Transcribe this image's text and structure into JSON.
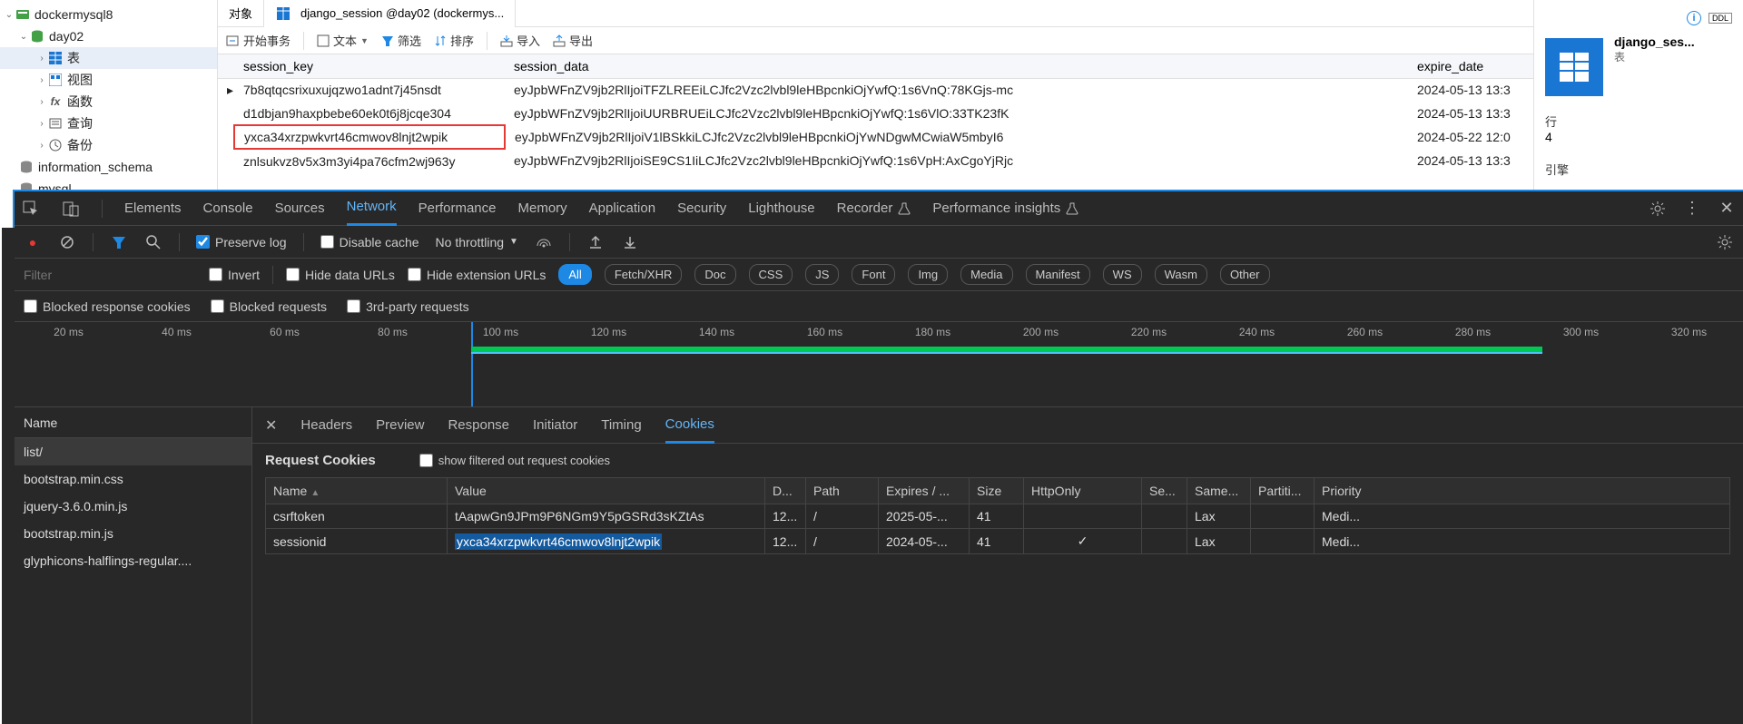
{
  "tree": {
    "root": "dockermysql8",
    "active_db": "day02",
    "nodes": {
      "tables": "表",
      "views": "视图",
      "functions": "函数",
      "queries": "查询",
      "backups": "备份"
    },
    "other_dbs": [
      "information_schema",
      "mysql"
    ]
  },
  "tabs": {
    "obj": "对象",
    "session": "django_session @day02 (dockermys..."
  },
  "toolbar": {
    "begin_tx": "开始事务",
    "text": "文本",
    "filter": "筛选",
    "sort": "排序",
    "import": "导入",
    "export": "导出"
  },
  "grid": {
    "headers": {
      "session_key": "session_key",
      "session_data": "session_data",
      "expire_date": "expire_date"
    },
    "rows": [
      {
        "key": "7b8qtqcsrixuxujqzwo1adnt7j45nsdt",
        "data": "eyJpbWFnZV9jb2RlIjoiTFZLREEiLCJfc2Vzc2lvbl9leHBpcnkiOjYwfQ:1s6VnQ:78KGjs-mc",
        "expire": "2024-05-13 13:3",
        "current": true
      },
      {
        "key": "d1dbjan9haxpbebe60ek0t6j8jcqe304",
        "data": "eyJpbWFnZV9jb2RlIjoiUURBRUEiLCJfc2Vzc2lvbl9leHBpcnkiOjYwfQ:1s6VlO:33TK23fK",
        "expire": "2024-05-13 13:3"
      },
      {
        "key": "yxca34xrzpwkvrt46cmwov8lnjt2wpik",
        "data": "eyJpbWFnZV9jb2RlIjoiV1lBSkkiLCJfc2Vzc2lvbl9leHBpcnkiOjYwNDgwMCwiaW5mbyI6",
        "expire": "2024-05-22 12:0",
        "highlight": true
      },
      {
        "key": "znlsukvz8v5x3m3yi4pa76cfm2wj963y",
        "data": "eyJpbWFnZV9jb2RlIjoiSE9CS1IiLCJfc2Vzc2lvbl9leHBpcnkiOjYwfQ:1s6VpH:AxCgoYjRjc",
        "expire": "2024-05-13 13:3"
      }
    ]
  },
  "info_panel": {
    "ddl": "DDL",
    "title": "django_ses...",
    "sub": "表",
    "rows_label": "行",
    "rows_value": "4",
    "engine_label": "引擎"
  },
  "devtools": {
    "tabs": [
      "Elements",
      "Console",
      "Sources",
      "Network",
      "Performance",
      "Memory",
      "Application",
      "Security",
      "Lighthouse",
      "Recorder",
      "Performance insights"
    ],
    "active_tab": "Network",
    "toolbar": {
      "preserve_log": "Preserve log",
      "disable_cache": "Disable cache",
      "throttling": "No throttling"
    },
    "filter_placeholder": "Filter",
    "filter_chips": {
      "invert": "Invert",
      "hide_data": "Hide data URLs",
      "hide_ext": "Hide extension URLs",
      "all": "All",
      "fetch": "Fetch/XHR",
      "doc": "Doc",
      "css": "CSS",
      "js": "JS",
      "font": "Font",
      "img": "Img",
      "media": "Media",
      "manifest": "Manifest",
      "ws": "WS",
      "wasm": "Wasm",
      "other": "Other"
    },
    "filter_row2": {
      "blocked_resp": "Blocked response cookies",
      "blocked_req": "Blocked requests",
      "third_party": "3rd-party requests"
    },
    "timeline": {
      "ticks": [
        "20 ms",
        "40 ms",
        "60 ms",
        "80 ms",
        "100 ms",
        "120 ms",
        "140 ms",
        "160 ms",
        "180 ms",
        "200 ms",
        "220 ms",
        "240 ms",
        "260 ms",
        "280 ms",
        "300 ms",
        "320 ms"
      ]
    },
    "requests": {
      "header": "Name",
      "items": [
        "list/",
        "bootstrap.min.css",
        "jquery-3.6.0.min.js",
        "bootstrap.min.js",
        "glyphicons-halflings-regular...."
      ]
    },
    "detail_tabs": [
      "Headers",
      "Preview",
      "Response",
      "Initiator",
      "Timing",
      "Cookies"
    ],
    "detail_active": "Cookies",
    "cookies": {
      "section": "Request Cookies",
      "show_filtered": "show filtered out request cookies",
      "headers": [
        "Name",
        "Value",
        "D...",
        "Path",
        "Expires / ...",
        "Size",
        "HttpOnly",
        "Se...",
        "Same...",
        "Partiti...",
        "Priority"
      ],
      "rows": [
        {
          "name": "csrftoken",
          "value": "tAapwGn9JPm9P6NGm9Y5pGSRd3sKZtAs",
          "domain": "12...",
          "path": "/",
          "expires": "2025-05-...",
          "size": "41",
          "httponly": "",
          "secure": "",
          "samesite": "Lax",
          "partition": "",
          "priority": "Medi..."
        },
        {
          "name": "sessionid",
          "value": "yxca34xrzpwkvrt46cmwov8lnjt2wpik",
          "domain": "12...",
          "path": "/",
          "expires": "2024-05-...",
          "size": "41",
          "httponly": "✓",
          "secure": "",
          "samesite": "Lax",
          "partition": "",
          "priority": "Medi...",
          "highlight": true
        }
      ]
    }
  }
}
